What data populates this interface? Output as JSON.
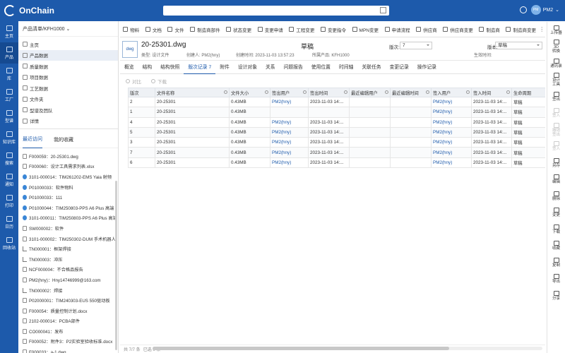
{
  "app": {
    "logo": "OnChain",
    "user": "PM2",
    "avatar_text": "PM"
  },
  "rail": [
    {
      "label": "主页",
      "icon": "home-icon"
    },
    {
      "label": "产品",
      "icon": "product-icon"
    },
    {
      "label": "库",
      "icon": "library-icon"
    },
    {
      "label": "工厂",
      "icon": "factory-icon"
    },
    {
      "label": "型谱",
      "icon": "spectrum-icon"
    },
    {
      "label": "知识库",
      "icon": "knowledge-icon"
    },
    {
      "label": "搜索",
      "icon": "search-icon"
    },
    {
      "label": "通知",
      "icon": "bell-icon"
    },
    {
      "label": "打印",
      "icon": "print-icon"
    },
    {
      "label": "日历",
      "icon": "calendar-icon"
    },
    {
      "label": "回收站",
      "icon": "trash-icon"
    }
  ],
  "left_panel": {
    "header": "产品清单/KFH1000",
    "tree": [
      {
        "label": "主页"
      },
      {
        "label": "产品数据"
      },
      {
        "label": "质量数据"
      },
      {
        "label": "项目数据"
      },
      {
        "label": "工艺数据"
      },
      {
        "label": "文件夹"
      },
      {
        "label": "型谱及团队"
      },
      {
        "label": "详情"
      }
    ],
    "tabs": [
      "最近访问",
      "我的收藏"
    ],
    "recent": [
      {
        "text": "F000059：20-25301.dwg",
        "icon": "file"
      },
      {
        "text": "F000060：设计工具需求列表.xlsx",
        "icon": "file"
      },
      {
        "text": "3101-000014：TIM261202-EMS Yaia 射频",
        "icon": "blue"
      },
      {
        "text": "P01000033：软件物料",
        "icon": "blue"
      },
      {
        "text": "P01000033：111",
        "icon": "blue"
      },
      {
        "text": "P01000044：TIM250803-PPS A6 Plus 高端",
        "icon": "blue"
      },
      {
        "text": "3101-000011：TIM250803-PPS A6 Plus 高端",
        "icon": "blue"
      },
      {
        "text": "SW000002：软件",
        "icon": "gear"
      },
      {
        "text": "3101-000002：TIM250302-DUM 手术机器人",
        "icon": "gear"
      },
      {
        "text": "TN000001：框架焊接",
        "icon": "tree"
      },
      {
        "text": "TN000003：冲压",
        "icon": "tree"
      },
      {
        "text": "NCF000004：不合格品报告",
        "icon": "file"
      },
      {
        "text": "PM2(hny)：Hny14746999@163.com",
        "icon": "file"
      },
      {
        "text": "TN000002：焊接",
        "icon": "tree"
      },
      {
        "text": "P02000001：TIM240303-EUS 550驱动板",
        "icon": "gear"
      },
      {
        "text": "F000054：质量控制计划.docx",
        "icon": "file"
      },
      {
        "text": "2102-000014：PCBA部件",
        "icon": "gear"
      },
      {
        "text": "CO000041：发布",
        "icon": "file"
      },
      {
        "text": "F000052：附件3：P2实验室验收标准.docx",
        "icon": "file"
      },
      {
        "text": "F000033：a-1.dwg",
        "icon": "file"
      }
    ]
  },
  "toolbar": [
    "物料",
    "文档",
    "文件",
    "制造商部件",
    "状态变更",
    "变更申请",
    "工程变更",
    "变更指令",
    "MPN变更",
    "申请流程",
    "供应商",
    "供应商变更",
    "制造商",
    "制造商变更"
  ],
  "header": {
    "thumb": "dwg",
    "title": "20-25301.dwg",
    "status": "草稿",
    "type": "类型: 设计文件",
    "creator": "创建人: PM2(hny)",
    "created": "创建时间: 2023-11-03 13:57:23",
    "product": "所属产品: KFH1000",
    "ver_label": "版次:",
    "ver_value": "7",
    "ban_label": "版本:",
    "ban_value": "草稿",
    "effective": "生效时间:"
  },
  "tabs": [
    "概览",
    "结构",
    "结构快照",
    "版次记录 7",
    "附件",
    "设计对象",
    "关系",
    "问题报告",
    "使用位置",
    "时间轴",
    "关联任务",
    "变更记录",
    "操作记录"
  ],
  "subtoolbar": {
    "compare": "对比",
    "download": "下载"
  },
  "table": {
    "columns": [
      "版次",
      "文件名称",
      "文件大小",
      "签出用户",
      "签出时间",
      "最近编辑用户",
      "最近编辑时间",
      "签入用户",
      "签入时间",
      "生命周期"
    ],
    "rows": [
      [
        "2",
        "20-25301",
        "0.43MB",
        "PM2(hny)",
        "2023-11-03 14:...",
        "",
        "",
        "PM2(hny)",
        "2023-11-03 14:...",
        "草稿"
      ],
      [
        "1",
        "20-25301",
        "0.43MB",
        "",
        "",
        "",
        "",
        "PM2(hny)",
        "2023-11-03 14:...",
        "草稿"
      ],
      [
        "4",
        "20-25301",
        "0.43MB",
        "PM2(hny)",
        "2023-11-03 14:...",
        "",
        "",
        "PM2(hny)",
        "2023-11-03 14:...",
        "草稿"
      ],
      [
        "5",
        "20-25301",
        "0.43MB",
        "PM2(hny)",
        "2023-11-03 14:...",
        "",
        "",
        "PM2(hny)",
        "2023-11-03 14:...",
        "草稿"
      ],
      [
        "3",
        "20-25301",
        "0.43MB",
        "PM2(hny)",
        "2023-11-03 14:...",
        "",
        "",
        "PM2(hny)",
        "2023-11-03 14:...",
        "草稿"
      ],
      [
        "7",
        "20-25301",
        "0.43MB",
        "PM2(hny)",
        "2023-11-03 14:...",
        "",
        "",
        "PM2(hny)",
        "2023-11-03 14:...",
        "草稿"
      ],
      [
        "6",
        "20-25301",
        "0.43MB",
        "PM2(hny)",
        "2023-11-03 14:...",
        "",
        "",
        "PM2(hny)",
        "2023-11-03 14:...",
        "草稿"
      ]
    ]
  },
  "footer": {
    "count": "共 7/7 条",
    "selected": "已选 0 条"
  },
  "right_rail": [
    {
      "label": "上传器",
      "disabled": false
    },
    {
      "label": "3D\n转换",
      "disabled": false
    },
    {
      "label": "通讯录",
      "disabled": false
    },
    {
      "label": "设计\n工具",
      "disabled": false
    },
    {
      "label": "签出",
      "disabled": false
    },
    {
      "label": "签入",
      "disabled": true
    },
    {
      "label": "撤销\n签出",
      "disabled": true
    },
    {
      "label": "签入",
      "disabled": true
    },
    {
      "label": "另存",
      "disabled": false
    },
    {
      "label": "编辑",
      "disabled": false
    },
    {
      "label": "删除",
      "disabled": false
    },
    {
      "label": "变更",
      "disabled": false
    },
    {
      "label": "下载",
      "disabled": false
    },
    {
      "label": "收藏",
      "disabled": false
    },
    {
      "label": "复制",
      "disabled": false
    },
    {
      "label": "导出",
      "disabled": false
    },
    {
      "label": "分享",
      "disabled": false
    }
  ],
  "colors": {
    "brand": "#1d5aab",
    "link": "#1d5aab"
  }
}
